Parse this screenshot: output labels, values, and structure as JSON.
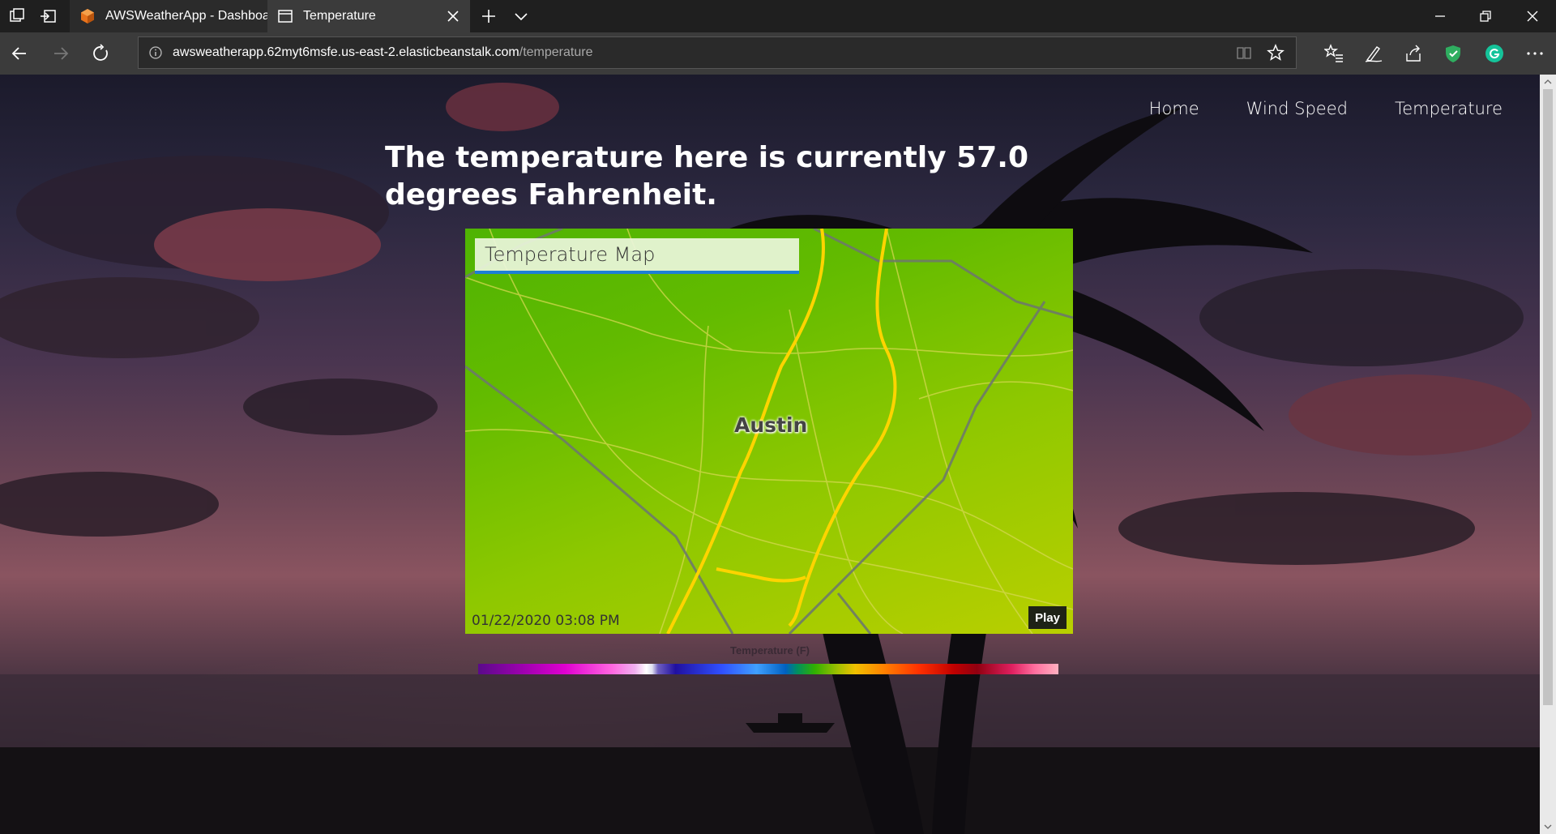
{
  "browser": {
    "tabs": [
      {
        "title": "AWSWeatherApp - Dashboa",
        "active": false,
        "icon": "aws-cube-icon"
      },
      {
        "title": "Temperature",
        "active": true,
        "icon": "page-icon"
      }
    ],
    "url_host": "awsweatherapp.62myt6msfe.us-east-2.elasticbeanstalk.com",
    "url_path": "/temperature"
  },
  "nav": {
    "home": "Home",
    "wind_speed": "Wind Speed",
    "temperature": "Temperature"
  },
  "headline": "The temperature here is currently 57.0 degrees Fahrenheit.",
  "map": {
    "title": "Temperature Map",
    "city": "Austin",
    "timestamp": "01/22/2020 03:08 PM",
    "play_label": "Play"
  },
  "legend": {
    "title": "Temperature (F)"
  },
  "colors": {
    "accent_blue": "#1d7fd6",
    "map_green": "#63bb00",
    "map_yellow": "#b9cf00"
  }
}
